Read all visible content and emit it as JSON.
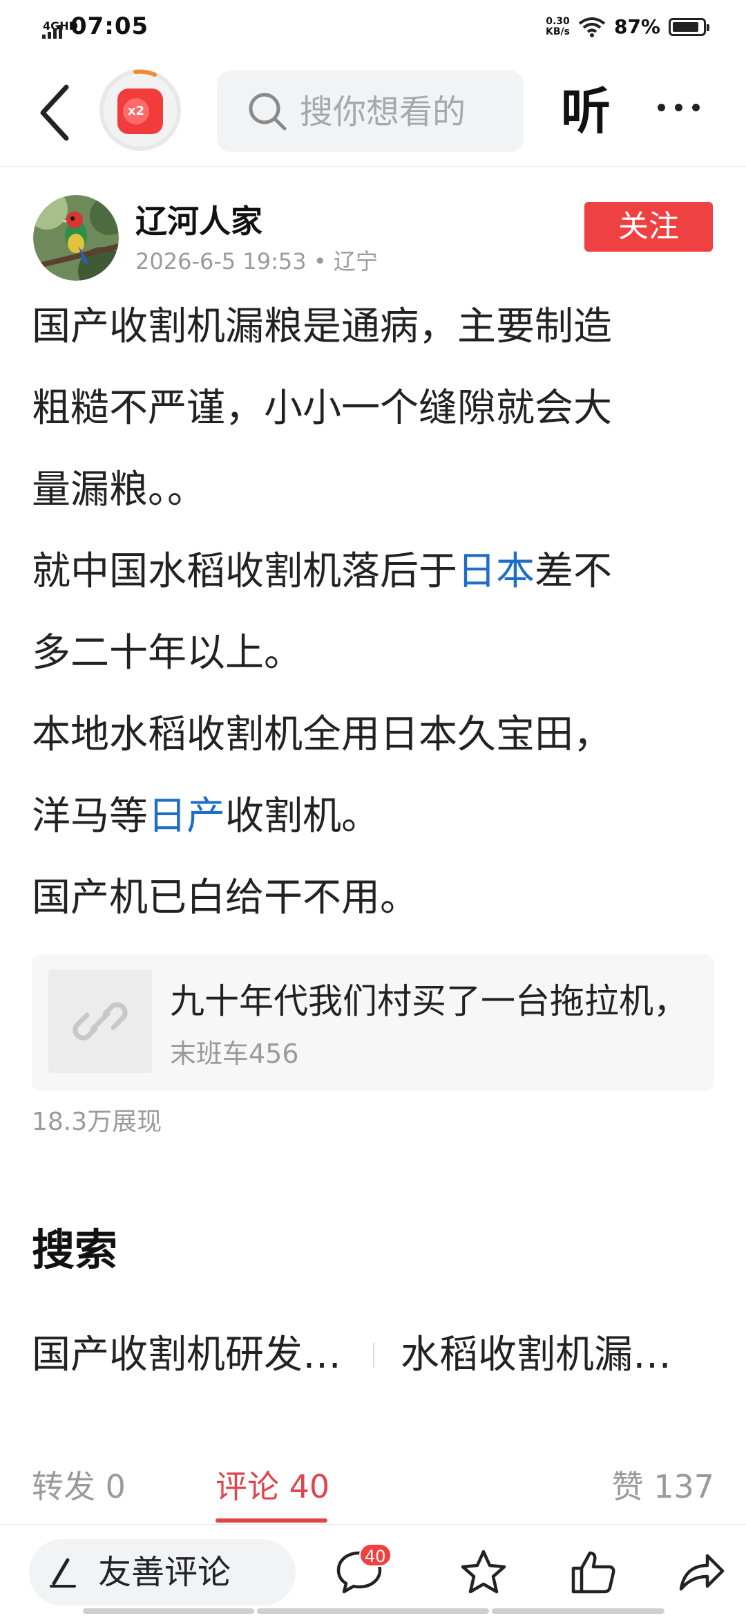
{
  "status_bar": {
    "network": "4GHD",
    "time": "07:05",
    "speed_value": "0.30",
    "speed_unit": "KB/s",
    "battery": "87%",
    "battery_level": 0.87
  },
  "nav": {
    "reward_label": "x2",
    "search_placeholder": "搜你想看的",
    "listen_label": "听"
  },
  "post": {
    "author": "辽河人家",
    "meta": "2026-6-5 19:53 • 辽宁",
    "follow_label": "关注",
    "lines": [
      [
        "国产收割机漏粮是通病，主要制造"
      ],
      [
        "粗糙不严谨，小小一个缝隙就会大"
      ],
      [
        "量漏粮。。"
      ],
      [
        "就中国水稻收割机落后于",
        "日本",
        "差不"
      ],
      [
        "多二十年以上。"
      ],
      [
        "本地水稻收割机全用日本久宝田，"
      ],
      [
        "洋马等",
        "日产",
        "收割机。"
      ],
      [
        "国产机已白给干不用。"
      ]
    ],
    "card": {
      "title": "九十年代我们村买了一台拖拉机，",
      "source": "末班车456"
    },
    "views": "18.3万展现"
  },
  "search_section": {
    "title": "搜索",
    "suggestions": [
      "国产收割机研发…",
      "水稻收割机漏…"
    ]
  },
  "tabs": {
    "repost": "转发 0",
    "comment": "评论 40",
    "like": "赞 137"
  },
  "bottom_bar": {
    "comment_placeholder": "友善评论",
    "comment_count": "40"
  },
  "colors": {
    "accent_red": "#f04142",
    "link_blue": "#1e6ec6"
  }
}
